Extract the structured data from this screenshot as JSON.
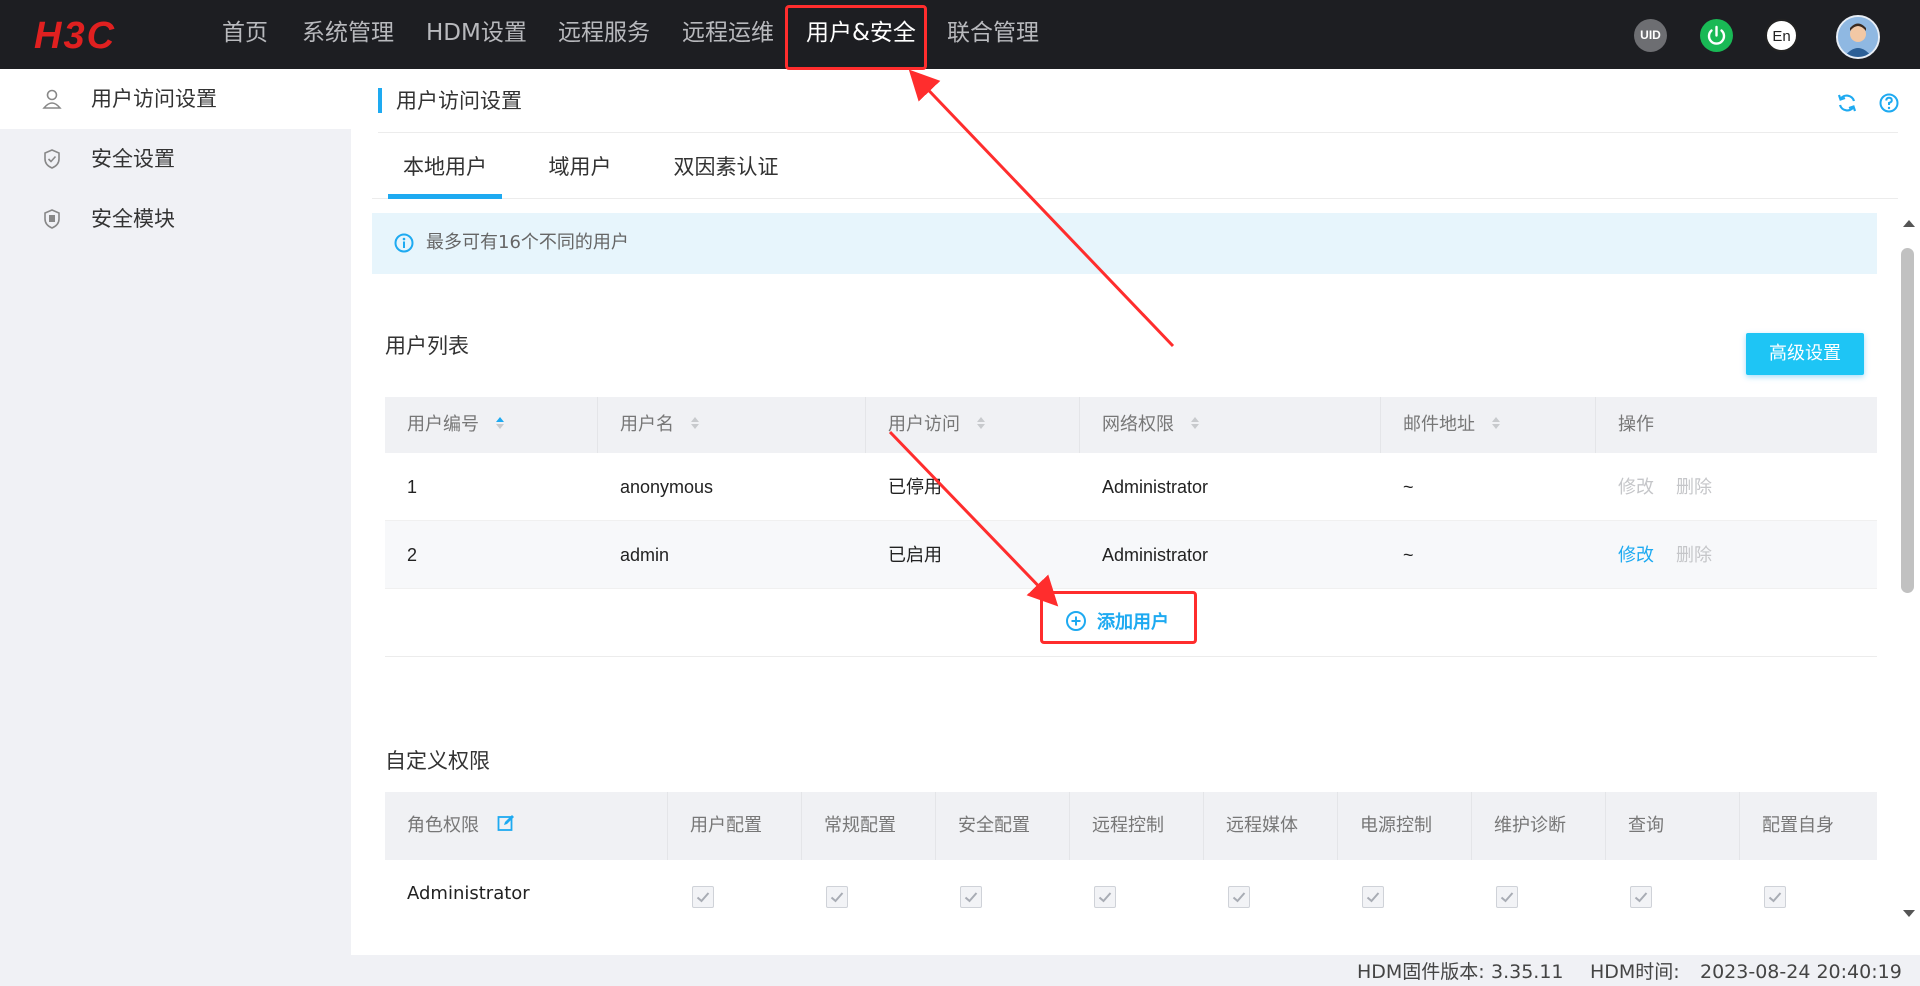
{
  "brand": {
    "logo_text": "H3C",
    "logo_color": "#e02020"
  },
  "topnav": {
    "items": [
      {
        "label": "首页"
      },
      {
        "label": "系统管理"
      },
      {
        "label": "HDM设置"
      },
      {
        "label": "远程服务"
      },
      {
        "label": "远程运维"
      },
      {
        "label": "用户&安全"
      },
      {
        "label": "联合管理"
      }
    ],
    "active": "用户&安全",
    "uid_label": "UID",
    "lang_label": "En"
  },
  "sidebar": {
    "items": [
      {
        "label": "用户访问设置",
        "icon": "user-icon",
        "active": true
      },
      {
        "label": "安全设置",
        "icon": "shield-check-icon",
        "active": false
      },
      {
        "label": "安全模块",
        "icon": "shield-module-icon",
        "active": false
      }
    ]
  },
  "page": {
    "title": "用户访问设置",
    "tabs": [
      {
        "label": "本地用户",
        "active": true
      },
      {
        "label": "域用户",
        "active": false
      },
      {
        "label": "双因素认证",
        "active": false
      }
    ],
    "info_text": "最多可有16个不同的用户"
  },
  "user_list": {
    "title": "用户列表",
    "advanced_button": "高级设置",
    "columns": [
      "用户编号",
      "用户名",
      "用户访问",
      "网络权限",
      "邮件地址",
      "操作"
    ],
    "rows": [
      {
        "id": "1",
        "username": "anonymous",
        "access": "已停用",
        "privilege": "Administrator",
        "email": "~",
        "edit": "修改",
        "delete": "删除",
        "edit_enabled": false
      },
      {
        "id": "2",
        "username": "admin",
        "access": "已启用",
        "privilege": "Administrator",
        "email": "~",
        "edit": "修改",
        "delete": "删除",
        "edit_enabled": true
      }
    ],
    "add_user": "添加用户"
  },
  "custom_permissions": {
    "title": "自定义权限",
    "role_header": "角色权限",
    "columns": [
      "用户配置",
      "常规配置",
      "安全配置",
      "远程控制",
      "远程媒体",
      "电源控制",
      "维护诊断",
      "查询",
      "配置自身"
    ],
    "rows": [
      {
        "role": "Administrator",
        "checked": [
          true,
          true,
          true,
          true,
          true,
          true,
          true,
          true,
          true
        ]
      }
    ]
  },
  "footer": {
    "firmware_label": "HDM固件版本:",
    "firmware_value": "3.35.11",
    "time_label": "HDM时间:",
    "time_value": "2023-08-24 20:40:19"
  },
  "colors": {
    "accent": "#1eaaf1",
    "topbar": "#1d1e22",
    "annotation": "#ff2d2d",
    "button": "#1ec5f5"
  }
}
